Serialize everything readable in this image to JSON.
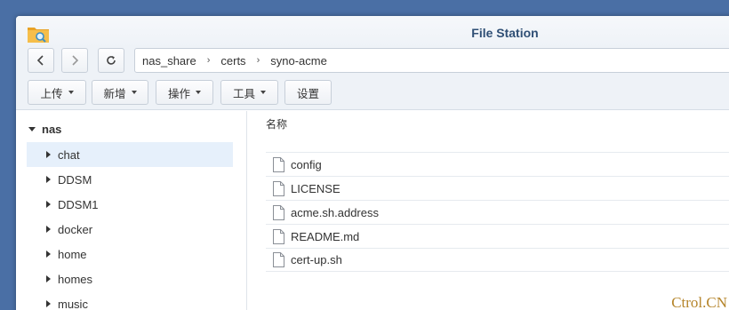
{
  "window": {
    "title": "File Station",
    "icon": "file-station-folder-icon"
  },
  "nav": {
    "back_icon": "chevron-left-icon",
    "forward_icon": "chevron-right-icon",
    "refresh_icon": "refresh-icon"
  },
  "breadcrumb": {
    "parts": [
      "nas_share",
      "certs",
      "syno-acme"
    ],
    "separator": "›"
  },
  "toolbar": {
    "upload": "上传",
    "create": "新增",
    "action": "操作",
    "tools": "工具",
    "settings": "设置"
  },
  "sidebar": {
    "root": "nas",
    "items": [
      {
        "label": "chat",
        "selected": true
      },
      {
        "label": "DDSM"
      },
      {
        "label": "DDSM1"
      },
      {
        "label": "docker"
      },
      {
        "label": "home"
      },
      {
        "label": "homes"
      },
      {
        "label": "music"
      }
    ]
  },
  "files": {
    "column_name": "名称",
    "rows": [
      "config",
      "LICENSE",
      "acme.sh.address",
      "README.md",
      "cert-up.sh"
    ]
  },
  "watermark": "Ctrol.CN",
  "colors": {
    "title": "#2f4f75",
    "selected_row": "#e6f0fb",
    "desktop": "#4a6fa5"
  }
}
